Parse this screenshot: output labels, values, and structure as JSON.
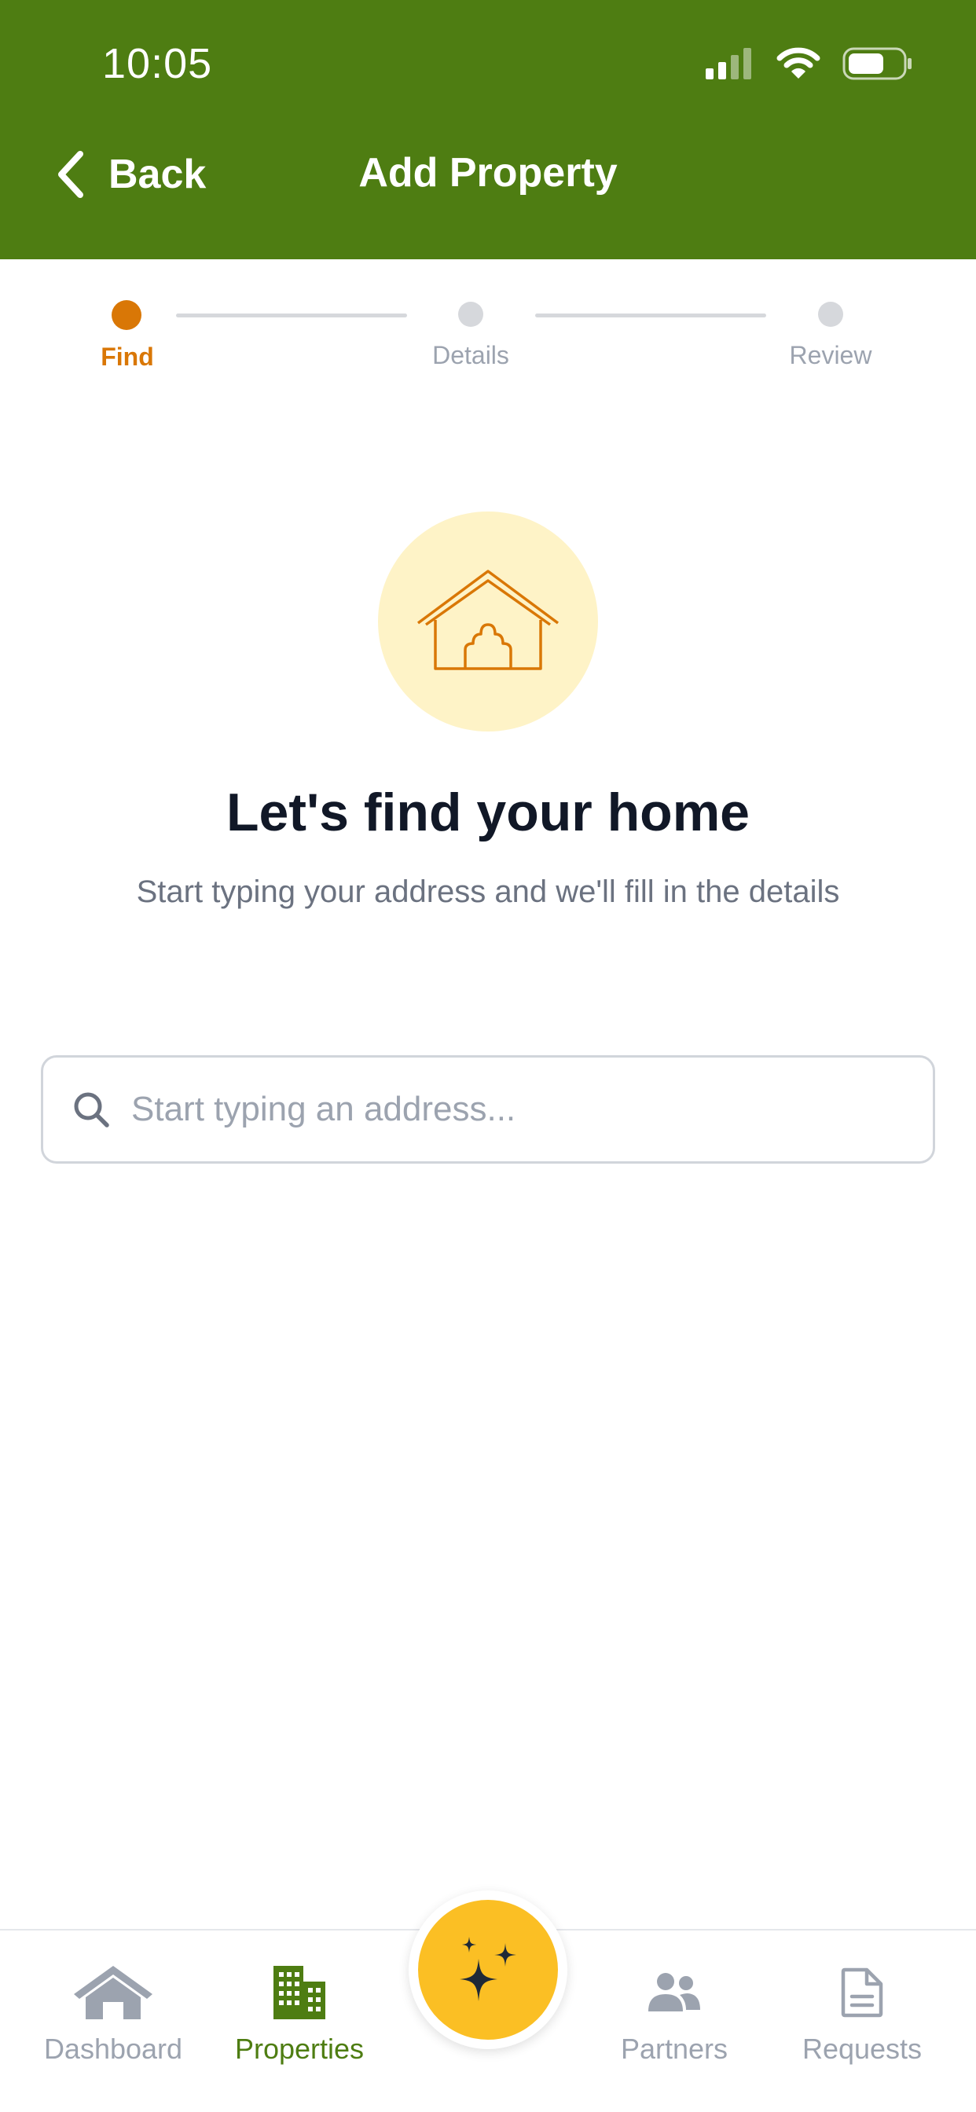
{
  "status_bar": {
    "time": "10:05",
    "icons": [
      "cellular-signal-icon",
      "wifi-icon",
      "battery-icon"
    ]
  },
  "header": {
    "back_label": "Back",
    "title": "Add Property",
    "background_color": "#4e7d12"
  },
  "stepper": {
    "steps": [
      {
        "label": "Find",
        "state": "active"
      },
      {
        "label": "Details",
        "state": "inactive"
      },
      {
        "label": "Review",
        "state": "inactive"
      }
    ],
    "active_color": "#d97706",
    "inactive_color": "#d6d8dc"
  },
  "hero": {
    "icon": "house-icon",
    "title": "Let's find your home",
    "subtitle": "Start typing your address and we'll fill in the details"
  },
  "search": {
    "icon": "search-icon",
    "placeholder": "Start typing an address...",
    "value": ""
  },
  "bottom_nav": {
    "items": [
      {
        "label": "Dashboard",
        "icon": "home-icon",
        "active": false
      },
      {
        "label": "Properties",
        "icon": "building-icon",
        "active": true
      },
      {
        "label": "Partners",
        "icon": "people-icon",
        "active": false
      },
      {
        "label": "Requests",
        "icon": "document-icon",
        "active": false
      }
    ],
    "fab_icon": "sparkles-icon",
    "active_color": "#4e7d12",
    "inactive_color": "#9ca3af",
    "fab_color": "#fbbf24"
  }
}
